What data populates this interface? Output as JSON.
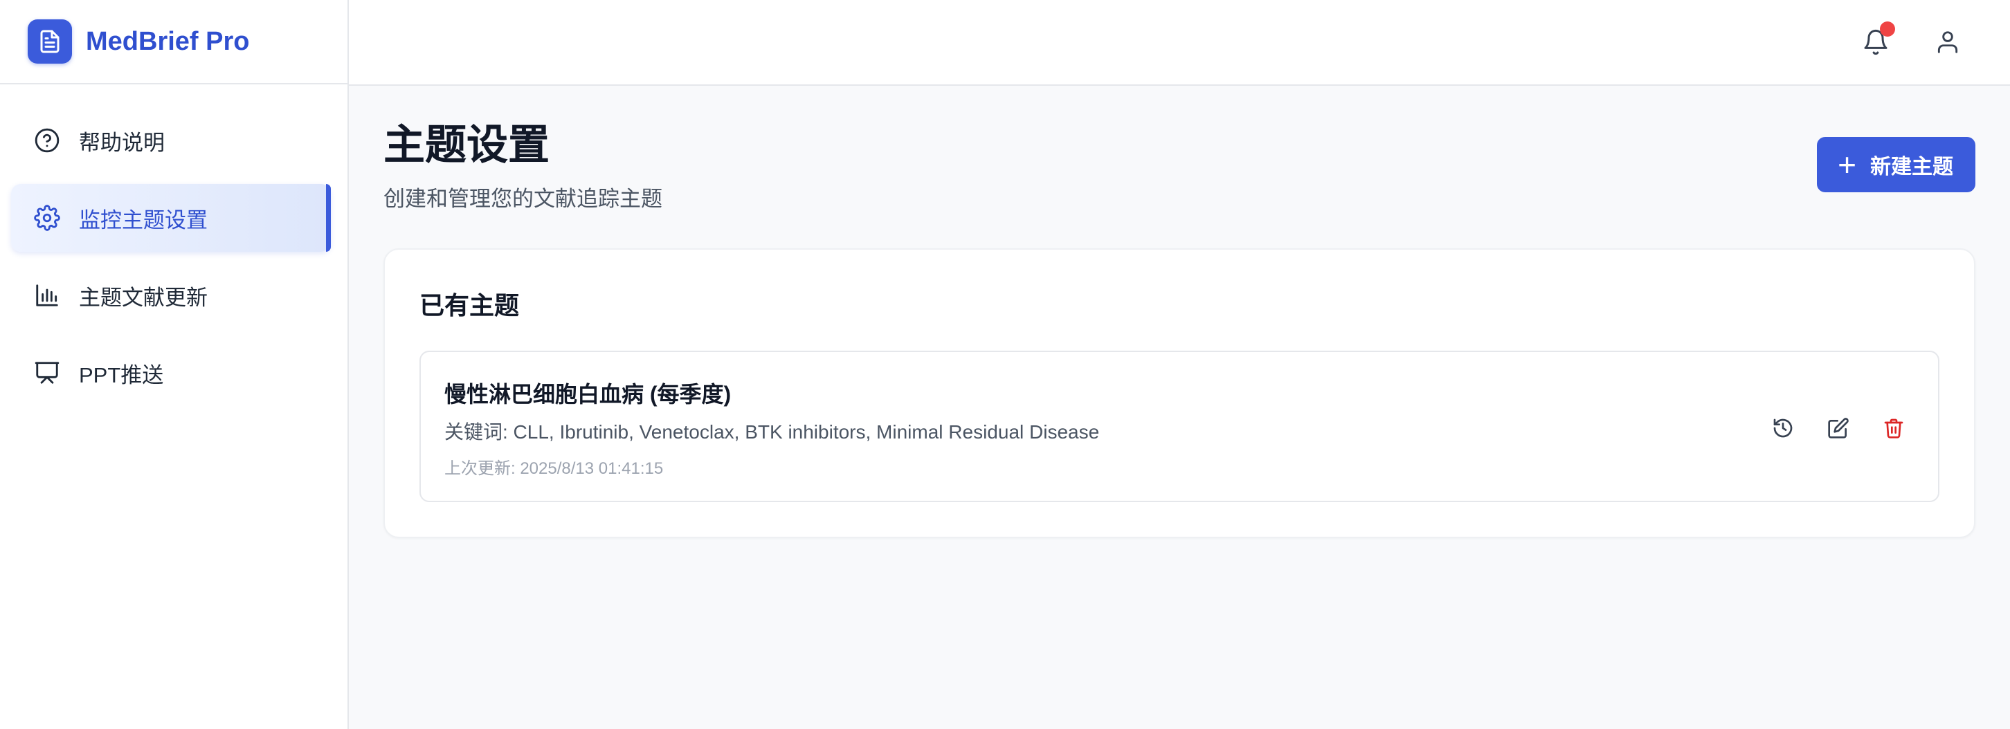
{
  "brand": {
    "name": "MedBrief Pro",
    "icon": "document-icon"
  },
  "sidebar": {
    "items": [
      {
        "label": "帮助说明",
        "icon": "help-circle-icon"
      },
      {
        "label": "监控主题设置",
        "icon": "gear-icon",
        "active": true
      },
      {
        "label": "主题文献更新",
        "icon": "bar-chart-icon"
      },
      {
        "label": "PPT推送",
        "icon": "presentation-icon"
      }
    ]
  },
  "topbar": {
    "bell_icon": "bell-icon",
    "user_icon": "user-icon",
    "has_notification": true
  },
  "page": {
    "title": "主题设置",
    "subtitle": "创建和管理您的文献追踪主题",
    "new_button": "新建主题"
  },
  "existing": {
    "title": "已有主题",
    "topics": [
      {
        "name": "慢性淋巴细胞白血病 (每季度)",
        "keywords": "关键词: CLL, Ibrutinib, Venetoclax, BTK inhibitors, Minimal Residual Disease",
        "updated": "上次更新: 2025/8/13 01:41:15"
      }
    ]
  },
  "colors": {
    "accent": "#3b5bdb",
    "danger": "#dc2626",
    "notification": "#ef4444"
  }
}
